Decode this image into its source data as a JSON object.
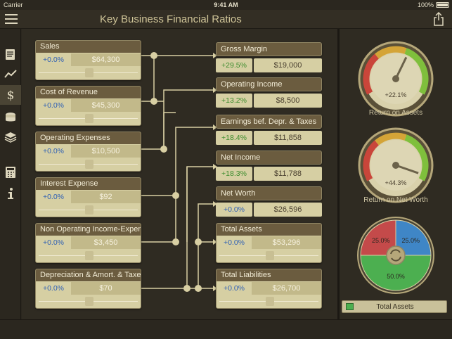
{
  "status": {
    "carrier": "Carrier",
    "time": "9:41 AM",
    "battery": "100%"
  },
  "header": {
    "title": "Key Business Financial Ratios"
  },
  "sidebar": {
    "icons": [
      "report-icon",
      "trend-chart-icon",
      "dollar-ratio-icon",
      "coins-icon",
      "layers-icon",
      "calculator-icon",
      "info-icon"
    ],
    "active_index": 2
  },
  "inputs": [
    {
      "label": "Sales",
      "change": "+0.0%",
      "value": "$64,300",
      "slider": 0.5
    },
    {
      "label": "Cost of Revenue",
      "change": "+0.0%",
      "value": "$45,300",
      "slider": 0.5
    },
    {
      "label": "Operating Expenses",
      "change": "+0.0%",
      "value": "$10,500",
      "slider": 0.5
    },
    {
      "label": "Interest Expense",
      "change": "+0.0%",
      "value": "$92",
      "slider": 0.5
    },
    {
      "label": "Non Operating Income-Expense",
      "change": "+0.0%",
      "value": "$3,450",
      "slider": 0.5
    },
    {
      "label": "Depreciation & Amort. & Taxes",
      "change": "+0.0%",
      "value": "$70",
      "slider": 0.5
    }
  ],
  "outputs": [
    {
      "label": "Gross Margin",
      "change": "+29.5%",
      "value": "$19,000"
    },
    {
      "label": "Operating Income",
      "change": "+13.2%",
      "value": "$8,500"
    },
    {
      "label": "Earnings bef. Depr. & Taxes",
      "change": "+18.4%",
      "value": "$11,858"
    },
    {
      "label": "Net Income",
      "change": "+18.3%",
      "value": "$11,788"
    },
    {
      "label": "Net Worth",
      "change": "+0.0%",
      "value": "$26,596"
    }
  ],
  "balance": [
    {
      "label": "Total Assets",
      "change": "+0.0%",
      "value": "$53,296",
      "slider": 0.5
    },
    {
      "label": "Total Liabilities",
      "change": "+0.0%",
      "value": "$26,700",
      "slider": 0.5
    }
  ],
  "gauges": [
    {
      "label": "Return on Assets",
      "value": "+22.1%",
      "level": 0.6
    },
    {
      "label": "Return on Net Worth",
      "value": "+44.3%",
      "level": 0.92
    }
  ],
  "pie": {
    "slices": [
      {
        "value": 25.0,
        "label": "25.0%",
        "color": "#c44a4a"
      },
      {
        "value": 25.0,
        "label": "25.0%",
        "color": "#3f86c6"
      },
      {
        "value": 50.0,
        "label": "50.0%",
        "color": "#4caf50"
      }
    ],
    "legend": "Total Assets"
  },
  "colors": {
    "background": "#2f2b22",
    "card": "#d6cfa3",
    "card_head": "#6b5c3f",
    "positive": "#3d8c2e",
    "neutral": "#2d5fb5",
    "wire": "#d8cfa3"
  }
}
